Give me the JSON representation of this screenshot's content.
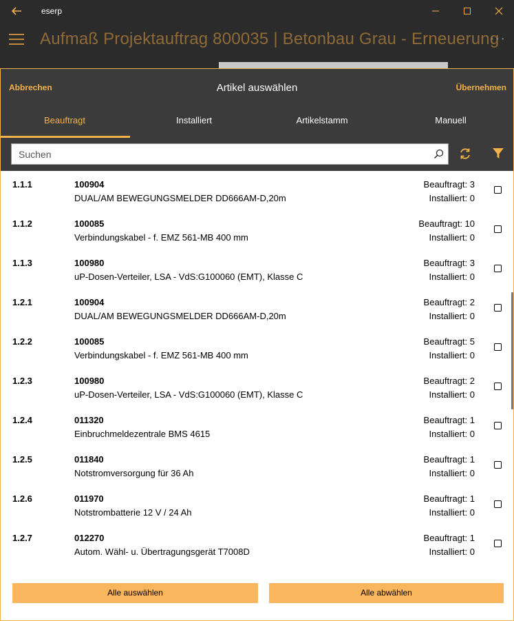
{
  "window": {
    "app_name": "eserp",
    "header_title": "Aufmaß Projektauftrag 800035  |  Betonbau Grau - Erneuerung",
    "more_glyph": "···"
  },
  "dialog": {
    "cancel_label": "Abbrechen",
    "title": "Artikel auswählen",
    "accept_label": "Übernehmen",
    "tabs": [
      {
        "label": "Beauftragt",
        "active": true
      },
      {
        "label": "Installiert",
        "active": false
      },
      {
        "label": "Artikelstamm",
        "active": false
      },
      {
        "label": "Manuell",
        "active": false
      }
    ],
    "search": {
      "placeholder": "Suchen",
      "value": ""
    },
    "items": [
      {
        "pos": "1.1.1",
        "number": "100904",
        "name": "DUAL/AM BEWEGUNGSMELDER DD666AM-D,20m",
        "ordered": "Beauftragt: 3",
        "installed": "Installiert: 0",
        "checked": false
      },
      {
        "pos": "1.1.2",
        "number": "100085",
        "name": "Verbindungskabel  -  f. EMZ 561-MB 400 mm",
        "ordered": "Beauftragt: 10",
        "installed": "Installiert: 0",
        "checked": false
      },
      {
        "pos": "1.1.3",
        "number": "100980",
        "name": "uP-Dosen-Verteiler,  LSA  -  VdS:G100060 (EMT), Klasse C",
        "ordered": "Beauftragt: 3",
        "installed": "Installiert: 0",
        "checked": false
      },
      {
        "pos": "1.2.1",
        "number": "100904",
        "name": "DUAL/AM BEWEGUNGSMELDER DD666AM-D,20m",
        "ordered": "Beauftragt: 2",
        "installed": "Installiert: 0",
        "checked": false
      },
      {
        "pos": "1.2.2",
        "number": "100085",
        "name": "Verbindungskabel  -  f. EMZ 561-MB 400 mm",
        "ordered": "Beauftragt: 5",
        "installed": "Installiert: 0",
        "checked": false
      },
      {
        "pos": "1.2.3",
        "number": "100980",
        "name": "uP-Dosen-Verteiler,  LSA  -  VdS:G100060 (EMT), Klasse C",
        "ordered": "Beauftragt: 2",
        "installed": "Installiert: 0",
        "checked": false
      },
      {
        "pos": "1.2.4",
        "number": "011320",
        "name": "Einbruchmeldezentrale BMS 4615",
        "ordered": "Beauftragt: 1",
        "installed": "Installiert: 0",
        "checked": false
      },
      {
        "pos": "1.2.5",
        "number": "011840",
        "name": "Notstromversorgung für 36 Ah",
        "ordered": "Beauftragt: 1",
        "installed": "Installiert: 0",
        "checked": false
      },
      {
        "pos": "1.2.6",
        "number": "011970",
        "name": "Notstrombatterie 12 V / 24 Ah",
        "ordered": "Beauftragt: 1",
        "installed": "Installiert: 0",
        "checked": false
      },
      {
        "pos": "1.2.7",
        "number": "012270",
        "name": "Autom. Wähl- u. Übertragungsgerät T7008D",
        "ordered": "Beauftragt: 1",
        "installed": "Installiert: 0",
        "checked": false
      }
    ],
    "select_all_label": "Alle auswählen",
    "deselect_all_label": "Alle abwählen"
  },
  "colors": {
    "accent": "#f3b14b",
    "button_fill": "#f9b65c",
    "header_bg": "#3b3b3b",
    "app_bg": "#2b2b2b"
  },
  "icons": [
    "back-arrow-icon",
    "minimize-icon",
    "maximize-icon",
    "close-icon",
    "hamburger-menu-icon",
    "more-icon",
    "search-icon",
    "refresh-icon",
    "filter-icon"
  ]
}
